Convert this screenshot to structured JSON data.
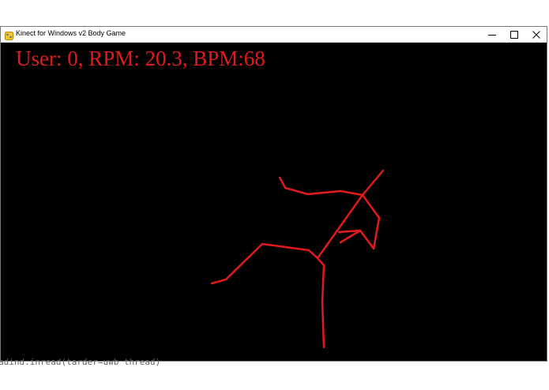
{
  "window": {
    "title": "Kinect for Windows v2 Body Game",
    "controls": {
      "minimize": "minimize",
      "maximize": "maximize",
      "close": "close"
    }
  },
  "hud": {
    "text": "User: 0, RPM: 20.3, BPM:68",
    "color": "#e31a1a"
  },
  "skeleton": {
    "color": "#e31a1a"
  },
  "console": {
    "bottom_text": "adind.inread(tarder=uwb thread)"
  },
  "colors": {
    "background": "#000000",
    "titlebar": "#ffffff"
  }
}
